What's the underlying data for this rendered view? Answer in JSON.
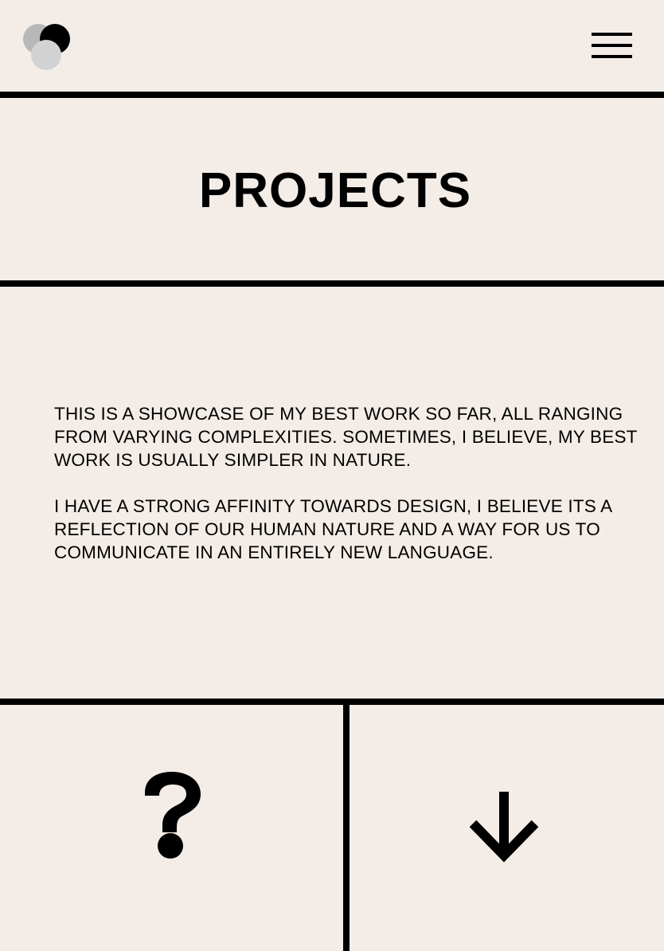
{
  "header": {
    "logo_icon": "overlapping-circles-logo",
    "menu_icon": "hamburger-menu-icon"
  },
  "page": {
    "title": "PROJECTS"
  },
  "intro": {
    "paragraphs": [
      "THIS IS A SHOWCASE OF MY BEST WORK SO FAR, ALL RANGING FROM VARYING COMPLEXITIES. SOMETIMES, I BELIEVE, MY BEST WORK IS USUALLY SIMPLER IN NATURE.",
      "I HAVE A STRONG AFFINITY TOWARDS DESIGN, I BELIEVE ITS A REFLECTION OF OUR HUMAN NATURE AND A WAY FOR US TO COMMUNICATE IN AN ENTIRELY NEW LANGUAGE."
    ]
  },
  "footer_tiles": {
    "left_icon": "question-mark-icon",
    "right_icon": "arrow-down-icon"
  },
  "colors": {
    "background": "#f4ede7",
    "ink": "#000000",
    "logo_light": "#d2d2d2",
    "logo_mid": "#b8b8b8"
  }
}
